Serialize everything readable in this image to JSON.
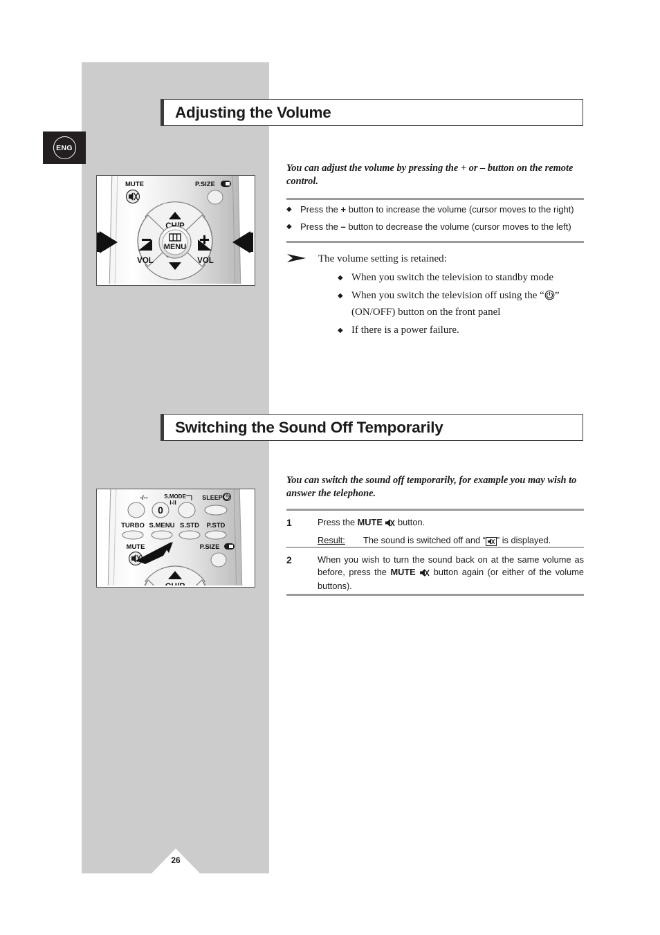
{
  "language_badge": {
    "label": "ENG"
  },
  "page_number": "26",
  "sections": [
    {
      "id": "adjusting-volume",
      "heading": "Adjusting the Volume",
      "intro": "You can adjust the volume by pressing the + or – button on the remote control.",
      "bullets": [
        {
          "prefix": "Press the ",
          "symbol": "+",
          "suffix": " button to increase the volume (cursor moves to the right)"
        },
        {
          "prefix": "Press the ",
          "symbol": "–",
          "suffix": " button to decrease the volume (cursor moves to the left)"
        }
      ],
      "note": {
        "title": "The volume setting is retained:",
        "items": [
          {
            "text": "When you switch the television to standby mode"
          },
          {
            "before": "When you switch the television off using the “",
            "icon": "power-on-off-icon",
            "after": "” (ON/OFF) button on the front panel"
          },
          {
            "text": "If there is a power failure."
          }
        ]
      },
      "remote": {
        "name": "remote-volume-diagram",
        "labels": {
          "mute": "MUTE",
          "psize": "P.SIZE",
          "ch_p_up": "CH/P",
          "ch_p_down": "CH/P",
          "vol_left": "VOL",
          "vol_right": "VOL",
          "minus": "–",
          "plus": "+",
          "menu": "MENU"
        }
      }
    },
    {
      "id": "switching-sound-off",
      "heading": "Switching the Sound Off Temporarily",
      "intro": "You can switch the sound off temporarily, for example you may wish to answer the telephone.",
      "steps": [
        {
          "number": "1",
          "text_before": "Press the ",
          "bold": "MUTE",
          "icon": "mute-icon",
          "text_after": " button.",
          "result_label": "Result:",
          "result_before": "The sound is switched off and “",
          "result_icon": "mute-boxed-icon",
          "result_after": "” is displayed."
        },
        {
          "number": "2",
          "text_before": "When you wish to turn the sound back on at the same volume as before, press the ",
          "bold": "MUTE",
          "icon": "mute-icon",
          "text_after": " button again (or either of the volume buttons)."
        }
      ],
      "remote": {
        "name": "remote-mute-diagram",
        "labels": {
          "dash_dash": "-/--",
          "zero": "0",
          "smode": "S.MODE",
          "i_ii": "I-II",
          "sleep": "SLEEP",
          "turbo": "TURBO",
          "smenu": "S.MENU",
          "sstd": "S.STD",
          "pstd": "P.STD",
          "mute": "MUTE",
          "psize": "P.SIZE",
          "ch_p": "CH/P"
        }
      }
    }
  ],
  "colors": {
    "grey_column": "#cccccc",
    "badge_bg": "#231f20",
    "heading_border": "#3b3b3b",
    "rule": "#9b9b9b",
    "text": "#1a1a1a"
  }
}
